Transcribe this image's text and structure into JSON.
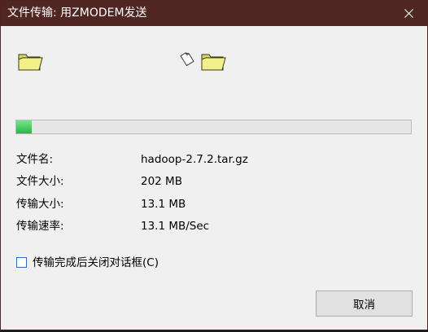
{
  "window": {
    "title": "文件传输: 用ZMODEM发送",
    "close_icon": "close-icon",
    "titlebar_color": "#4f2621"
  },
  "transfer": {
    "progress_percent": 4,
    "progress_color": "#27b943"
  },
  "info": [
    {
      "label": "文件名:",
      "value": "hadoop-2.7.2.tar.gz"
    },
    {
      "label": "文件大小:",
      "value": "202 MB"
    },
    {
      "label": "传输大小:",
      "value": "13.1 MB"
    },
    {
      "label": "传输速率:",
      "value": "13.1 MB/Sec"
    }
  ],
  "options": {
    "close_after_label": "传输完成后关闭对话框(C)",
    "close_after_checked": false
  },
  "buttons": {
    "cancel_label": "取消"
  }
}
